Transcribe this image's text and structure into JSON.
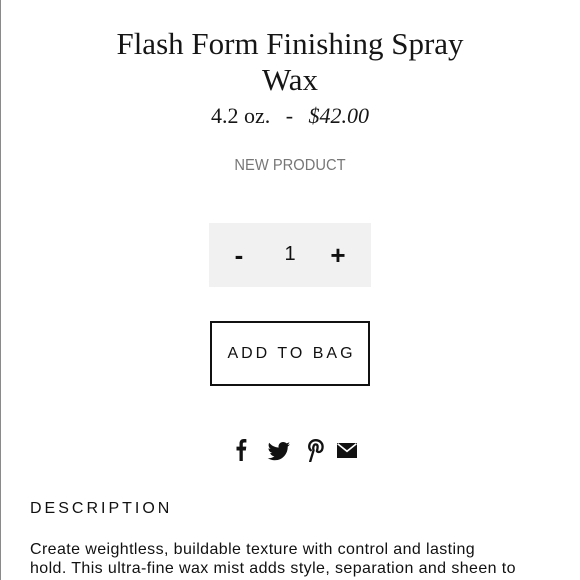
{
  "product": {
    "title_line1": "Flash Form Finishing Spray",
    "title_line2": "Wax",
    "size": "4.2 oz.",
    "separator": "-",
    "price": "$42.00",
    "badge": "NEW PRODUCT"
  },
  "quantity": {
    "minus_label": "-",
    "value": "1",
    "plus_label": "+"
  },
  "actions": {
    "add_to_bag": "ADD TO BAG"
  },
  "share": {
    "icons": [
      "facebook-icon",
      "twitter-icon",
      "pinterest-icon",
      "email-icon"
    ]
  },
  "description": {
    "heading": "DESCRIPTION",
    "line1": "Create weightless, buildable texture with control and lasting",
    "line2": "hold. This ultra-fine wax mist adds style, separation and sheen to"
  },
  "colors": {
    "text": "#111111",
    "muted": "#777777",
    "qty_background": "#f1f1f1",
    "border": "#111111"
  }
}
